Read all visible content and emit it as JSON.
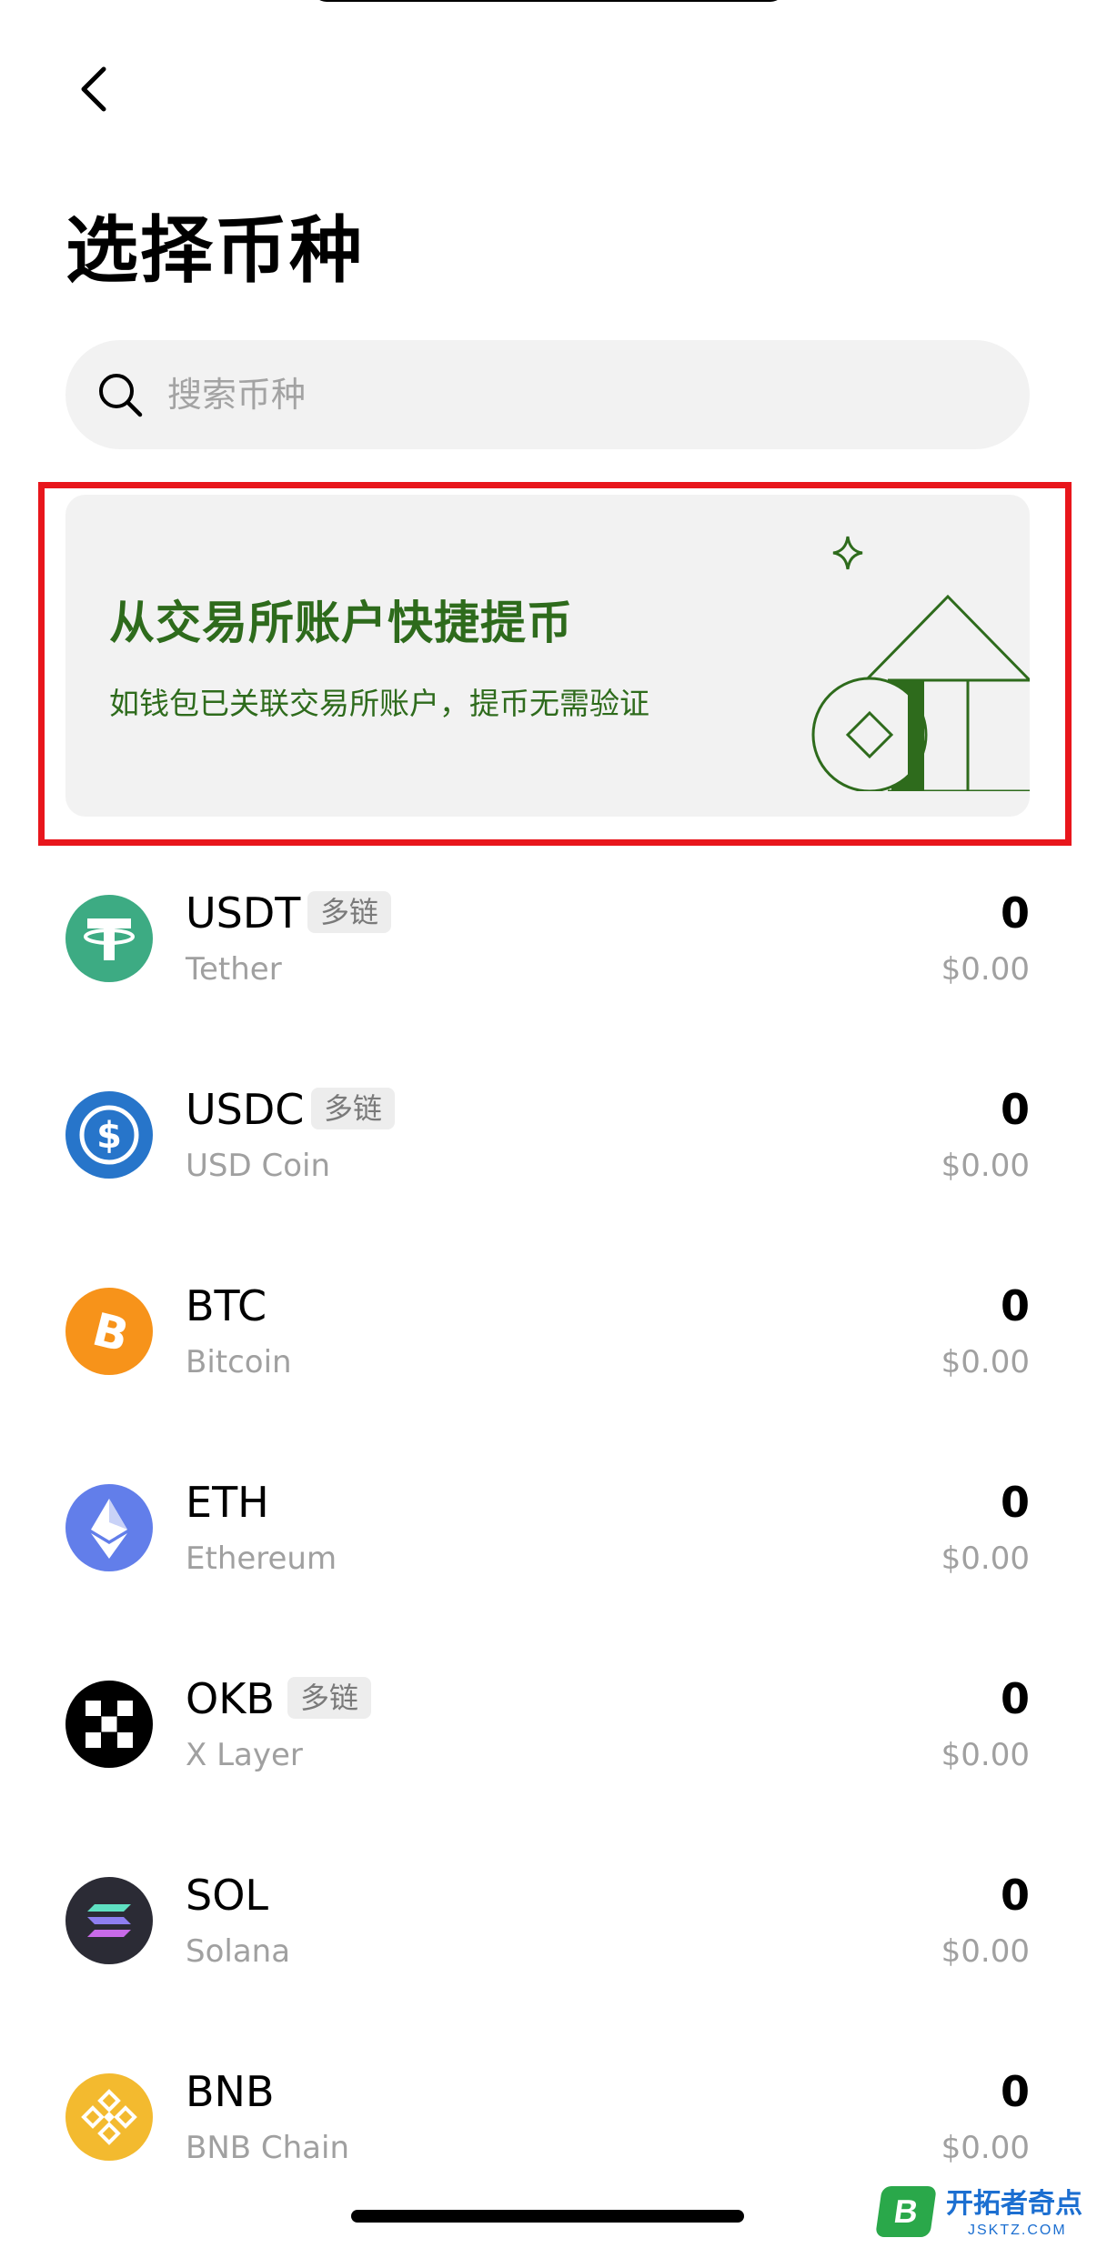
{
  "header": {
    "back_icon": "chevron-left-icon",
    "title": "选择币种"
  },
  "search": {
    "icon": "search-icon",
    "placeholder": "搜索币种",
    "value": ""
  },
  "promo": {
    "title": "从交易所账户快捷提币",
    "subtitle": "如钱包已关联交易所账户，提币无需验证",
    "text_color": "#2e6b1c",
    "highlight_color": "#e8161c",
    "illustration": "exchange-building-coin-illustration"
  },
  "coins": [
    {
      "symbol": "USDT",
      "tag": "多链",
      "name": "Tether",
      "balance": "0",
      "value": "$0.00",
      "icon": "tether-icon",
      "color": "#3dab83"
    },
    {
      "symbol": "USDC",
      "tag": "多链",
      "name": "USD Coin",
      "balance": "0",
      "value": "$0.00",
      "icon": "usdc-icon",
      "color": "#2775ca"
    },
    {
      "symbol": "BTC",
      "name": "Bitcoin",
      "balance": "0",
      "value": "$0.00",
      "icon": "bitcoin-icon",
      "color": "#f7931a"
    },
    {
      "symbol": "ETH",
      "name": "Ethereum",
      "balance": "0",
      "value": "$0.00",
      "icon": "ethereum-icon",
      "color": "#627eea"
    },
    {
      "symbol": "OKB",
      "tag": "多链",
      "name": "X Layer",
      "balance": "0",
      "value": "$0.00",
      "icon": "okb-icon",
      "color": "#000000"
    },
    {
      "symbol": "SOL",
      "name": "Solana",
      "balance": "0",
      "value": "$0.00",
      "icon": "solana-icon",
      "color": "#2b2b35"
    },
    {
      "symbol": "BNB",
      "name": "BNB Chain",
      "balance": "0",
      "value": "$0.00",
      "icon": "bnb-icon",
      "color": "#f3ba2f"
    }
  ],
  "watermark": {
    "text": "开拓者奇点",
    "url": "JSKTZ.COM",
    "badge": "B"
  }
}
